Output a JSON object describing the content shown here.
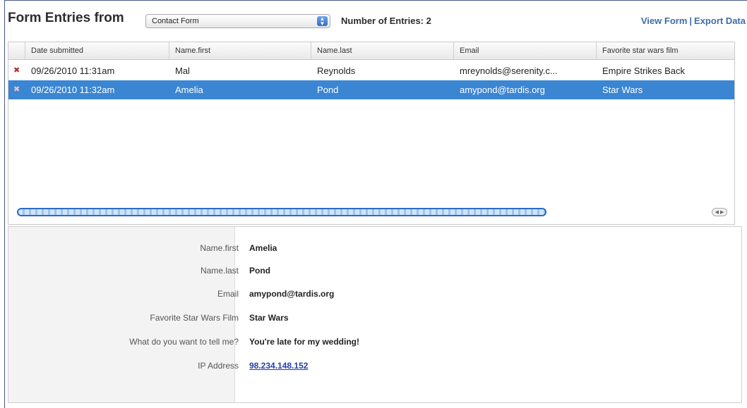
{
  "header": {
    "title": "Form Entries from",
    "form_select": "Contact Form",
    "entries_count": "Number of Entries: 2",
    "view_form": "View Form",
    "separator": "|",
    "export_data": "Export Data"
  },
  "table": {
    "columns": [
      "Date submitted",
      "Name.first",
      "Name.last",
      "Email",
      "Favorite star wars film"
    ],
    "rows": [
      {
        "date": "09/26/2010 11:31am",
        "first": "Mal",
        "last": "Reynolds",
        "email": "mreynolds@serenity.c...",
        "film": "Empire Strikes Back",
        "selected": false
      },
      {
        "date": "09/26/2010 11:32am",
        "first": "Amelia",
        "last": "Pond",
        "email": "amypond@tardis.org",
        "film": "Star Wars",
        "selected": true
      }
    ],
    "delete_icon": "x-icon"
  },
  "detail": {
    "fields": [
      {
        "label": "Name.first",
        "value": "Amelia"
      },
      {
        "label": "Name.last",
        "value": "Pond"
      },
      {
        "label": "Email",
        "value": "amypond@tardis.org"
      },
      {
        "label": "Favorite Star Wars Film",
        "value": "Star Wars"
      },
      {
        "label": "What do you want to tell me?",
        "value": "You're late for my wedding!"
      },
      {
        "label": "IP Address",
        "value": "98.234.148.152"
      }
    ]
  },
  "colors": {
    "selection": "#3b86d2",
    "link": "#3d6ea8",
    "ip_link": "#1f3fa6",
    "frame_border": "#4a5a88"
  }
}
